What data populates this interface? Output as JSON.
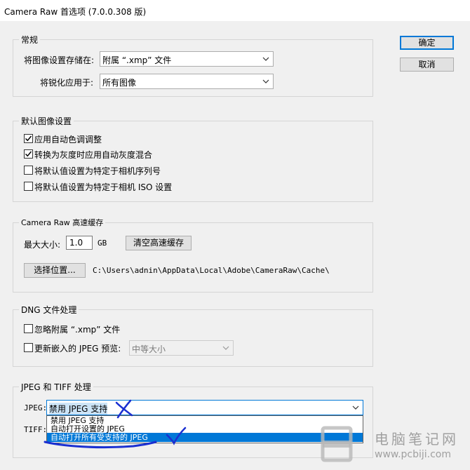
{
  "window": {
    "title": "Camera Raw 首选项  (7.0.0.308 版)"
  },
  "buttons": {
    "ok": "确定",
    "cancel": "取消"
  },
  "general": {
    "legend": "常规",
    "save_label": "将图像设置存储在:",
    "save_value": "附属 “.xmp” 文件",
    "sharpen_label": "将锐化应用于:",
    "sharpen_value": "所有图像"
  },
  "defaults": {
    "legend": "默认图像设置",
    "items": [
      {
        "label": "应用自动色调调整",
        "checked": true
      },
      {
        "label": "转换为灰度时应用自动灰度混合",
        "checked": true
      },
      {
        "label": "将默认值设置为特定于相机序列号",
        "checked": false
      },
      {
        "label": "将默认值设置为特定于相机 ISO 设置",
        "checked": false
      }
    ]
  },
  "cache": {
    "legend": "Camera Raw 高速缓存",
    "max_size_label": "最大大小:",
    "max_size_value": "1.0",
    "unit": "GB",
    "purge_button": "清空高速缓存",
    "select_location_button": "选择位置...",
    "path": "C:\\Users\\adnin\\AppData\\Local\\Adobe\\CameraRaw\\Cache\\"
  },
  "dng": {
    "legend": "DNG 文件处理",
    "ignore_label": "忽略附属 “.xmp” 文件",
    "ignore_checked": false,
    "update_label": "更新嵌入的 JPEG 预览:",
    "update_checked": false,
    "preview_value": "中等大小"
  },
  "jpeg_tiff": {
    "legend": "JPEG 和 TIFF 处理",
    "jpeg_label": "JPEG:",
    "jpeg_value": "禁用 JPEG 支持",
    "tiff_label": "TIFF:",
    "options": [
      "禁用 JPEG 支持",
      "自动打开设置的 JPEG",
      "自动打开所有受支持的 JPEG"
    ],
    "selected_index": 2
  },
  "watermark": {
    "name": "电脑笔记网",
    "url": "www.pcbiji.com"
  },
  "colors": {
    "accent": "#0078d7",
    "annotation": "#1a2fd1",
    "dialog_bg": "#f0f0f0"
  }
}
